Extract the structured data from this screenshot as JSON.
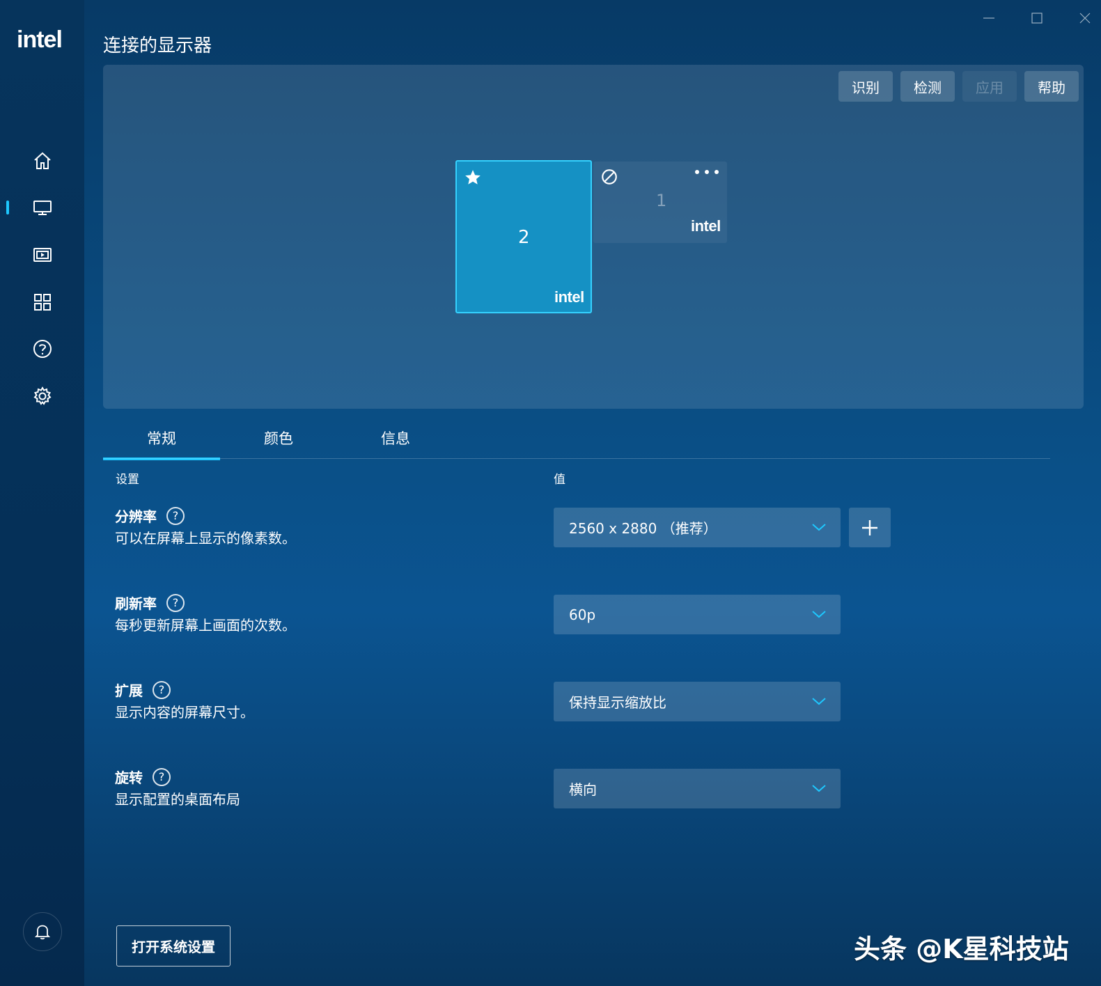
{
  "app": {
    "logo": "intel"
  },
  "header": {
    "title": "连接的显示器"
  },
  "toolbar": {
    "identify": "识别",
    "detect": "检测",
    "apply": "应用",
    "help": "帮助"
  },
  "monitors": [
    {
      "number": "2",
      "logo": "intel",
      "primary": true
    },
    {
      "number": "1",
      "logo": "intel",
      "primary": false
    }
  ],
  "tabs": [
    {
      "label": "常规",
      "active": true
    },
    {
      "label": "颜色",
      "active": false
    },
    {
      "label": "信息",
      "active": false
    }
  ],
  "columns": {
    "setting": "设置",
    "value": "值"
  },
  "settings": [
    {
      "title": "分辨率",
      "desc": "可以在屏幕上显示的像素数。",
      "value": "2560 x 2880 （推荐）"
    },
    {
      "title": "刷新率",
      "desc": "每秒更新屏幕上画面的次数。",
      "value": "60p"
    },
    {
      "title": "扩展",
      "desc": "显示内容的屏幕尺寸。",
      "value": "保持显示缩放比"
    },
    {
      "title": "旋转",
      "desc": "显示配置的桌面布局",
      "value": "横向"
    }
  ],
  "help_mark": "?",
  "footer": {
    "open_settings": "打开系统设置"
  },
  "watermark": "头条 @K星科技站",
  "icons": {
    "sidebar": [
      "home-icon",
      "display-icon",
      "media-icon",
      "apps-icon",
      "help-icon",
      "settings-icon"
    ],
    "bell": "bell-icon"
  },
  "colors": {
    "accent": "#1ec8ff",
    "primary_monitor": "#1591c4"
  }
}
